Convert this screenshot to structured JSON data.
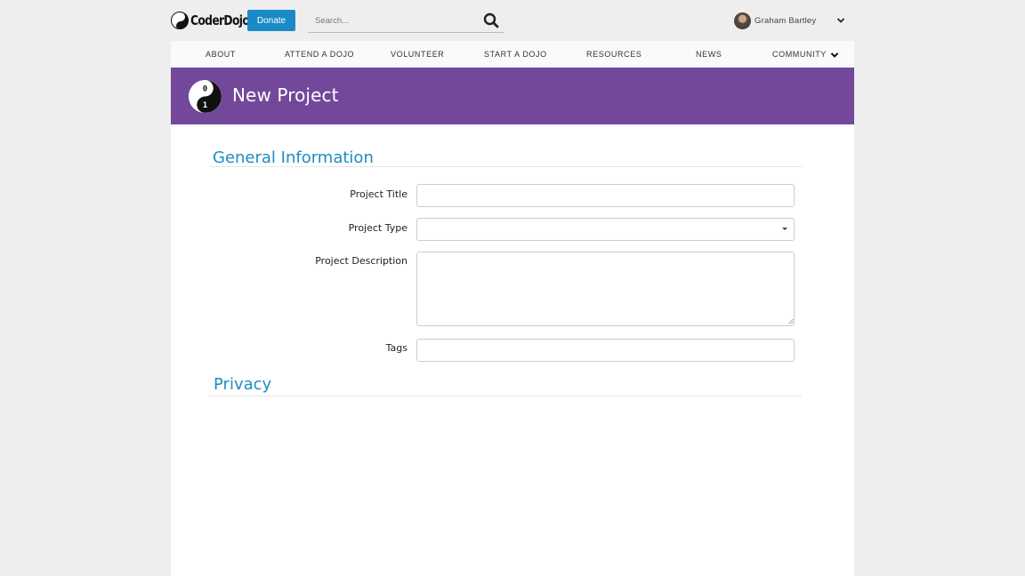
{
  "header": {
    "logo_text": "CoderDojo",
    "donate_label": "Donate",
    "search_placeholder": "Search...",
    "user_name": "Graham Bartley"
  },
  "nav": {
    "items": [
      "About",
      "Attend a Dojo",
      "Volunteer",
      "Start a Dojo",
      "Resources",
      "News",
      "Community"
    ]
  },
  "banner": {
    "title": "New Project",
    "logo_digits": [
      "0",
      "1"
    ]
  },
  "form": {
    "general_heading": "General Information",
    "privacy_heading": "Privacy",
    "fields": {
      "title_label": "Project Title",
      "title_value": "",
      "type_label": "Project Type",
      "type_value": "",
      "description_label": "Project Description",
      "description_value": "",
      "tags_label": "Tags",
      "tags_value": ""
    }
  },
  "colors": {
    "brand_purple": "#73489b",
    "accent_blue": "#1f8bc4",
    "donate_blue": "#1a8ac6"
  }
}
